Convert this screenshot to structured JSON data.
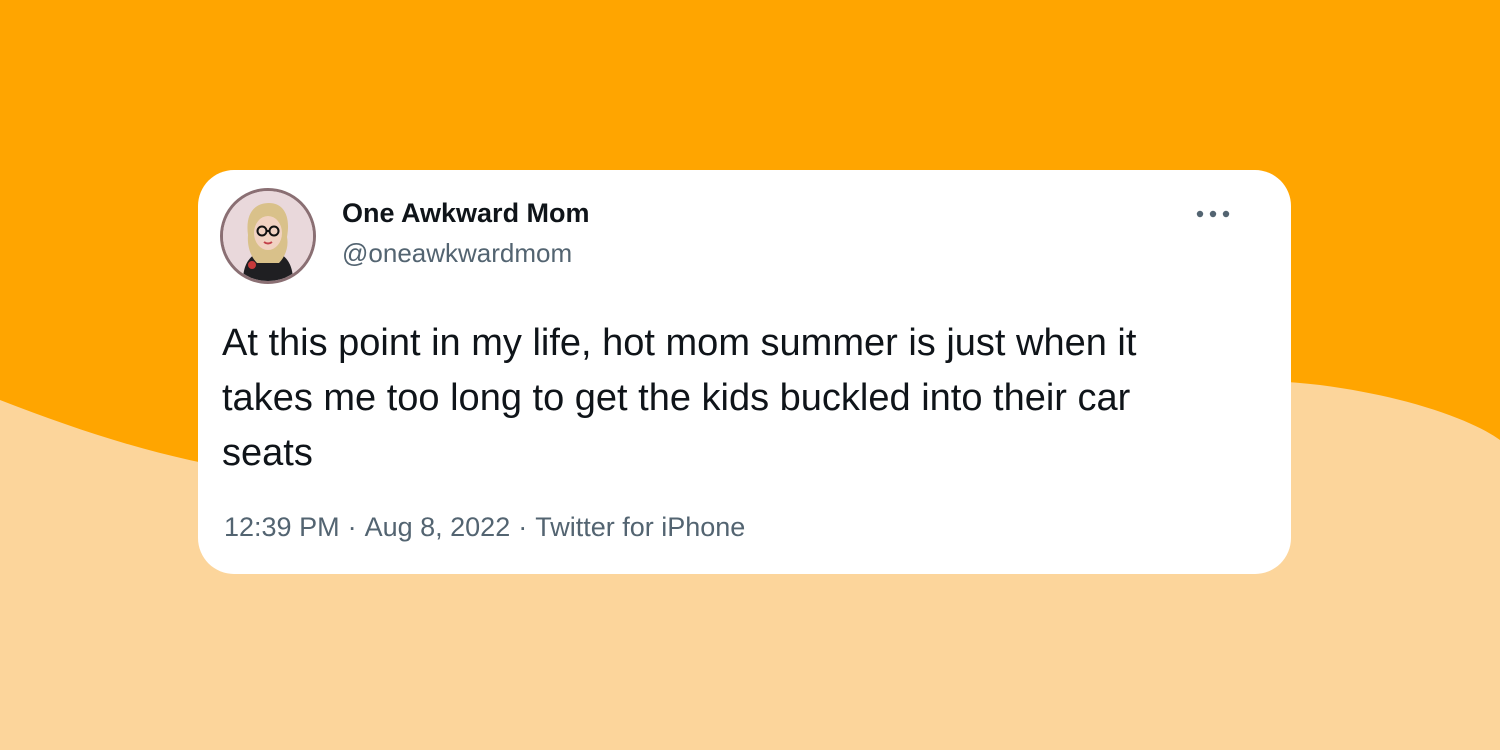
{
  "colors": {
    "background_top": "#FFA500",
    "background_wave": "#FCD59B",
    "card": "#FFFFFF",
    "text_primary": "#0F1419",
    "text_secondary": "#536471"
  },
  "tweet": {
    "author": {
      "display_name": "One Awkward Mom",
      "handle": "@oneawkwardmom",
      "avatar_icon": "avatar-illustration"
    },
    "more_icon": "more-dots-icon",
    "text": "At this point in my life, hot mom summer is just when it takes me too long to get the kids buckled into their car seats",
    "meta": {
      "time": "12:39 PM",
      "separator": "·",
      "date": "Aug 8, 2022",
      "source": "Twitter for iPhone"
    }
  }
}
